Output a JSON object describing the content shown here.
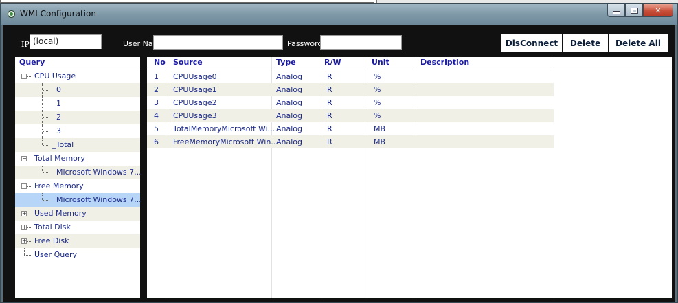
{
  "window": {
    "title": "WMI Configuration",
    "icon": "app-icon"
  },
  "toolbar": {
    "ip_label": "IP",
    "ip_value": "(local)",
    "username_label": "User Name",
    "username_value": "",
    "password_label": "Password",
    "password_value": "",
    "disconnect_label": "DisConnect",
    "delete_label": "Delete",
    "delete_all_label": "Delete All"
  },
  "tree": {
    "header": "Query",
    "nodes": [
      {
        "label": "CPU Usage",
        "expander": "−"
      },
      {
        "label": "0"
      },
      {
        "label": "1"
      },
      {
        "label": "2"
      },
      {
        "label": "3"
      },
      {
        "label": "_Total"
      },
      {
        "label": "Total Memory",
        "expander": "−"
      },
      {
        "label": "Microsoft Windows 7..."
      },
      {
        "label": "Free Memory",
        "expander": "−"
      },
      {
        "label": "Microsoft Windows 7..."
      },
      {
        "label": "Used Memory",
        "expander": "+"
      },
      {
        "label": "Total Disk",
        "expander": "+"
      },
      {
        "label": "Free Disk",
        "expander": "+"
      },
      {
        "label": "User Query"
      }
    ]
  },
  "table": {
    "columns": [
      "No",
      "Source",
      "Type",
      "R/W",
      "Unit",
      "Description"
    ],
    "rows": [
      {
        "no": "1",
        "source": "CPUUsage0",
        "type": "Analog",
        "rw": "R",
        "unit": "%",
        "description": ""
      },
      {
        "no": "2",
        "source": "CPUUsage1",
        "type": "Analog",
        "rw": "R",
        "unit": "%",
        "description": ""
      },
      {
        "no": "3",
        "source": "CPUUsage2",
        "type": "Analog",
        "rw": "R",
        "unit": "%",
        "description": ""
      },
      {
        "no": "4",
        "source": "CPUUsage3",
        "type": "Analog",
        "rw": "R",
        "unit": "%",
        "description": ""
      },
      {
        "no": "5",
        "source": "TotalMemoryMicrosoft Wi...",
        "type": "Analog",
        "rw": "R",
        "unit": "MB",
        "description": ""
      },
      {
        "no": "6",
        "source": "FreeMemoryMicrosoft Win...",
        "type": "Analog",
        "rw": "R",
        "unit": "MB",
        "description": ""
      }
    ]
  },
  "colors": {
    "accent": "#1c2a8a",
    "selection": "#b7d6f7",
    "alt_row": "#f0f0e6",
    "background": "#111111"
  }
}
